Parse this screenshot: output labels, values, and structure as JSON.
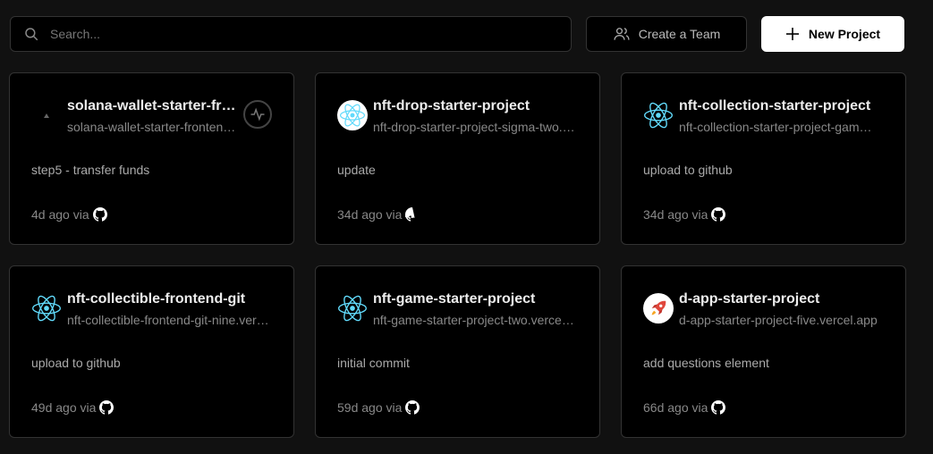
{
  "search": {
    "placeholder": "Search..."
  },
  "actions": {
    "create_team_label": "Create a Team",
    "new_project_label": "New Project"
  },
  "projects": [
    {
      "name": "solana-wallet-starter-frontend",
      "url": "solana-wallet-starter-frontend.vercel.app",
      "commit": "step5 - transfer funds",
      "age": "4d ago via",
      "icon": "vercel-triangle-icon",
      "activity": true
    },
    {
      "name": "nft-drop-starter-project",
      "url": "nft-drop-starter-project-sigma-two.vercel.app",
      "commit": "update",
      "age": "34d ago via",
      "icon": "react-icon-white-bg",
      "activity": false
    },
    {
      "name": "nft-collection-starter-project",
      "url": "nft-collection-starter-project-gamma.vercel.app",
      "commit": "upload to github",
      "age": "34d ago via",
      "icon": "react-icon",
      "activity": false
    },
    {
      "name": "nft-collectible-frontend-git",
      "url": "nft-collectible-frontend-git-nine.vercel.app",
      "commit": "upload to github",
      "age": "49d ago via",
      "icon": "react-icon",
      "activity": false
    },
    {
      "name": "nft-game-starter-project",
      "url": "nft-game-starter-project-two.vercel.app",
      "commit": "initial commit",
      "age": "59d ago via",
      "icon": "react-icon",
      "activity": false
    },
    {
      "name": "d-app-starter-project",
      "url": "d-app-starter-project-five.vercel.app",
      "commit": "add questions element",
      "age": "66d ago via",
      "icon": "rocket-icon",
      "activity": false
    }
  ],
  "colors": {
    "background": "#111111",
    "card": "#000000",
    "border": "#333333",
    "react": "#61dafb"
  }
}
